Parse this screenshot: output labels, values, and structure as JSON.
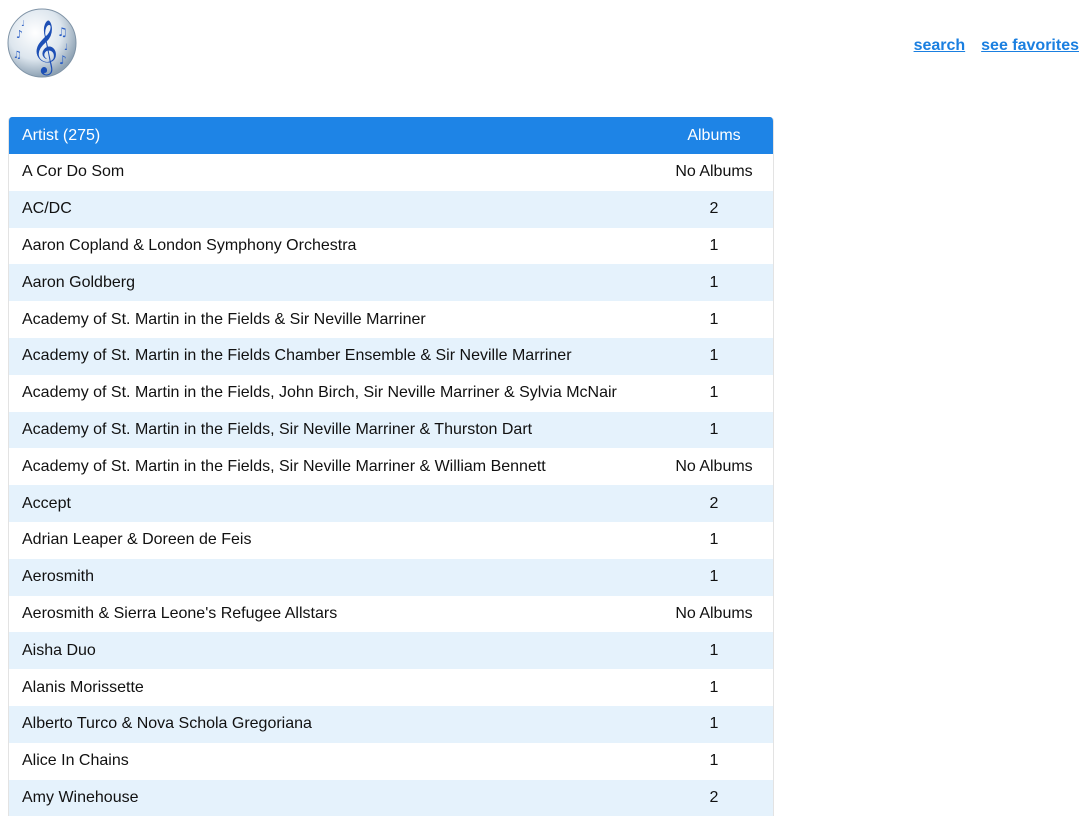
{
  "header": {
    "logo_icon": "music-notes-globe-icon",
    "nav": {
      "search_label": "search",
      "favorites_label": "see favorites"
    }
  },
  "table": {
    "columns": {
      "artist": "Artist (275)",
      "albums": "Albums"
    },
    "rows": [
      {
        "artist": "A Cor Do Som",
        "albums": "No Albums"
      },
      {
        "artist": "AC/DC",
        "albums": "2"
      },
      {
        "artist": "Aaron Copland & London Symphony Orchestra",
        "albums": "1"
      },
      {
        "artist": "Aaron Goldberg",
        "albums": "1"
      },
      {
        "artist": "Academy of St. Martin in the Fields & Sir Neville Marriner",
        "albums": "1"
      },
      {
        "artist": "Academy of St. Martin in the Fields Chamber Ensemble & Sir Neville Marriner",
        "albums": "1"
      },
      {
        "artist": "Academy of St. Martin in the Fields, John Birch, Sir Neville Marriner & Sylvia McNair",
        "albums": "1"
      },
      {
        "artist": "Academy of St. Martin in the Fields, Sir Neville Marriner & Thurston Dart",
        "albums": "1"
      },
      {
        "artist": "Academy of St. Martin in the Fields, Sir Neville Marriner & William Bennett",
        "albums": "No Albums"
      },
      {
        "artist": "Accept",
        "albums": "2"
      },
      {
        "artist": "Adrian Leaper & Doreen de Feis",
        "albums": "1"
      },
      {
        "artist": "Aerosmith",
        "albums": "1"
      },
      {
        "artist": "Aerosmith & Sierra Leone's Refugee Allstars",
        "albums": "No Albums"
      },
      {
        "artist": "Aisha Duo",
        "albums": "1"
      },
      {
        "artist": "Alanis Morissette",
        "albums": "1"
      },
      {
        "artist": "Alberto Turco & Nova Schola Gregoriana",
        "albums": "1"
      },
      {
        "artist": "Alice In Chains",
        "albums": "1"
      },
      {
        "artist": "Amy Winehouse",
        "albums": "2"
      }
    ]
  },
  "colors": {
    "header_bg": "#1e84e6",
    "row_alt_bg": "#e5f2fc",
    "link": "#1a7fe0"
  }
}
